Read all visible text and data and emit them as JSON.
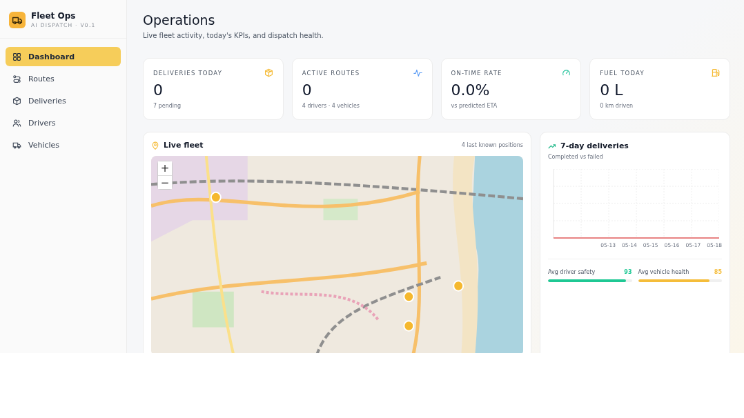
{
  "brand": {
    "name": "Fleet Ops",
    "subtitle": "AI DISPATCH · V0.1"
  },
  "nav": [
    {
      "label": "Dashboard",
      "selected": true
    },
    {
      "label": "Routes",
      "selected": false
    },
    {
      "label": "Deliveries",
      "selected": false
    },
    {
      "label": "Drivers",
      "selected": false
    },
    {
      "label": "Vehicles",
      "selected": false
    }
  ],
  "header": {
    "title": "Operations",
    "subtitle": "Live fleet activity, today's KPIs, and dispatch health."
  },
  "kpis": [
    {
      "label": "DELIVERIES TODAY",
      "value": "0",
      "note": "7 pending"
    },
    {
      "label": "ACTIVE ROUTES",
      "value": "0",
      "note": "4 drivers · 4 vehicles"
    },
    {
      "label": "ON-TIME RATE",
      "value": "0.0%",
      "note": "vs predicted ETA"
    },
    {
      "label": "FUEL TODAY",
      "value": "0 L",
      "note": "0 km driven"
    }
  ],
  "live_fleet": {
    "title": "Live fleet",
    "note": "4 last known positions",
    "zoom_in": "+",
    "zoom_out": "−"
  },
  "deliveries_chart": {
    "title": "7-day deliveries",
    "subtitle": "Completed vs failed",
    "x_labels": [
      "05-13",
      "05-14",
      "05-15",
      "05-16",
      "05-17",
      "05-18"
    ]
  },
  "metrics": [
    {
      "label": "Avg driver safety",
      "value": "93",
      "level": 0.93,
      "color": "#1fc894"
    },
    {
      "label": "Avg vehicle health",
      "value": "85",
      "level": 0.85,
      "color": "#f5bd3a"
    }
  ]
}
